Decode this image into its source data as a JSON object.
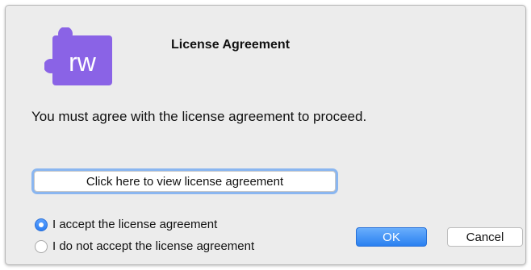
{
  "dialog": {
    "title": "License Agreement",
    "message": "You must agree with the license agreement to proceed.",
    "app_icon": {
      "name": "rw-puzzle-icon",
      "text": "rw",
      "color": "#8a63e6"
    },
    "view_button_label": "Click here to view license agreement",
    "options": [
      {
        "label": "I accept the license agreement",
        "selected": true
      },
      {
        "label": "I do not accept the license agreement",
        "selected": false
      }
    ],
    "ok_label": "OK",
    "cancel_label": "Cancel"
  },
  "colors": {
    "accent": "#2d7ff3",
    "dialog_background": "#ececec"
  }
}
